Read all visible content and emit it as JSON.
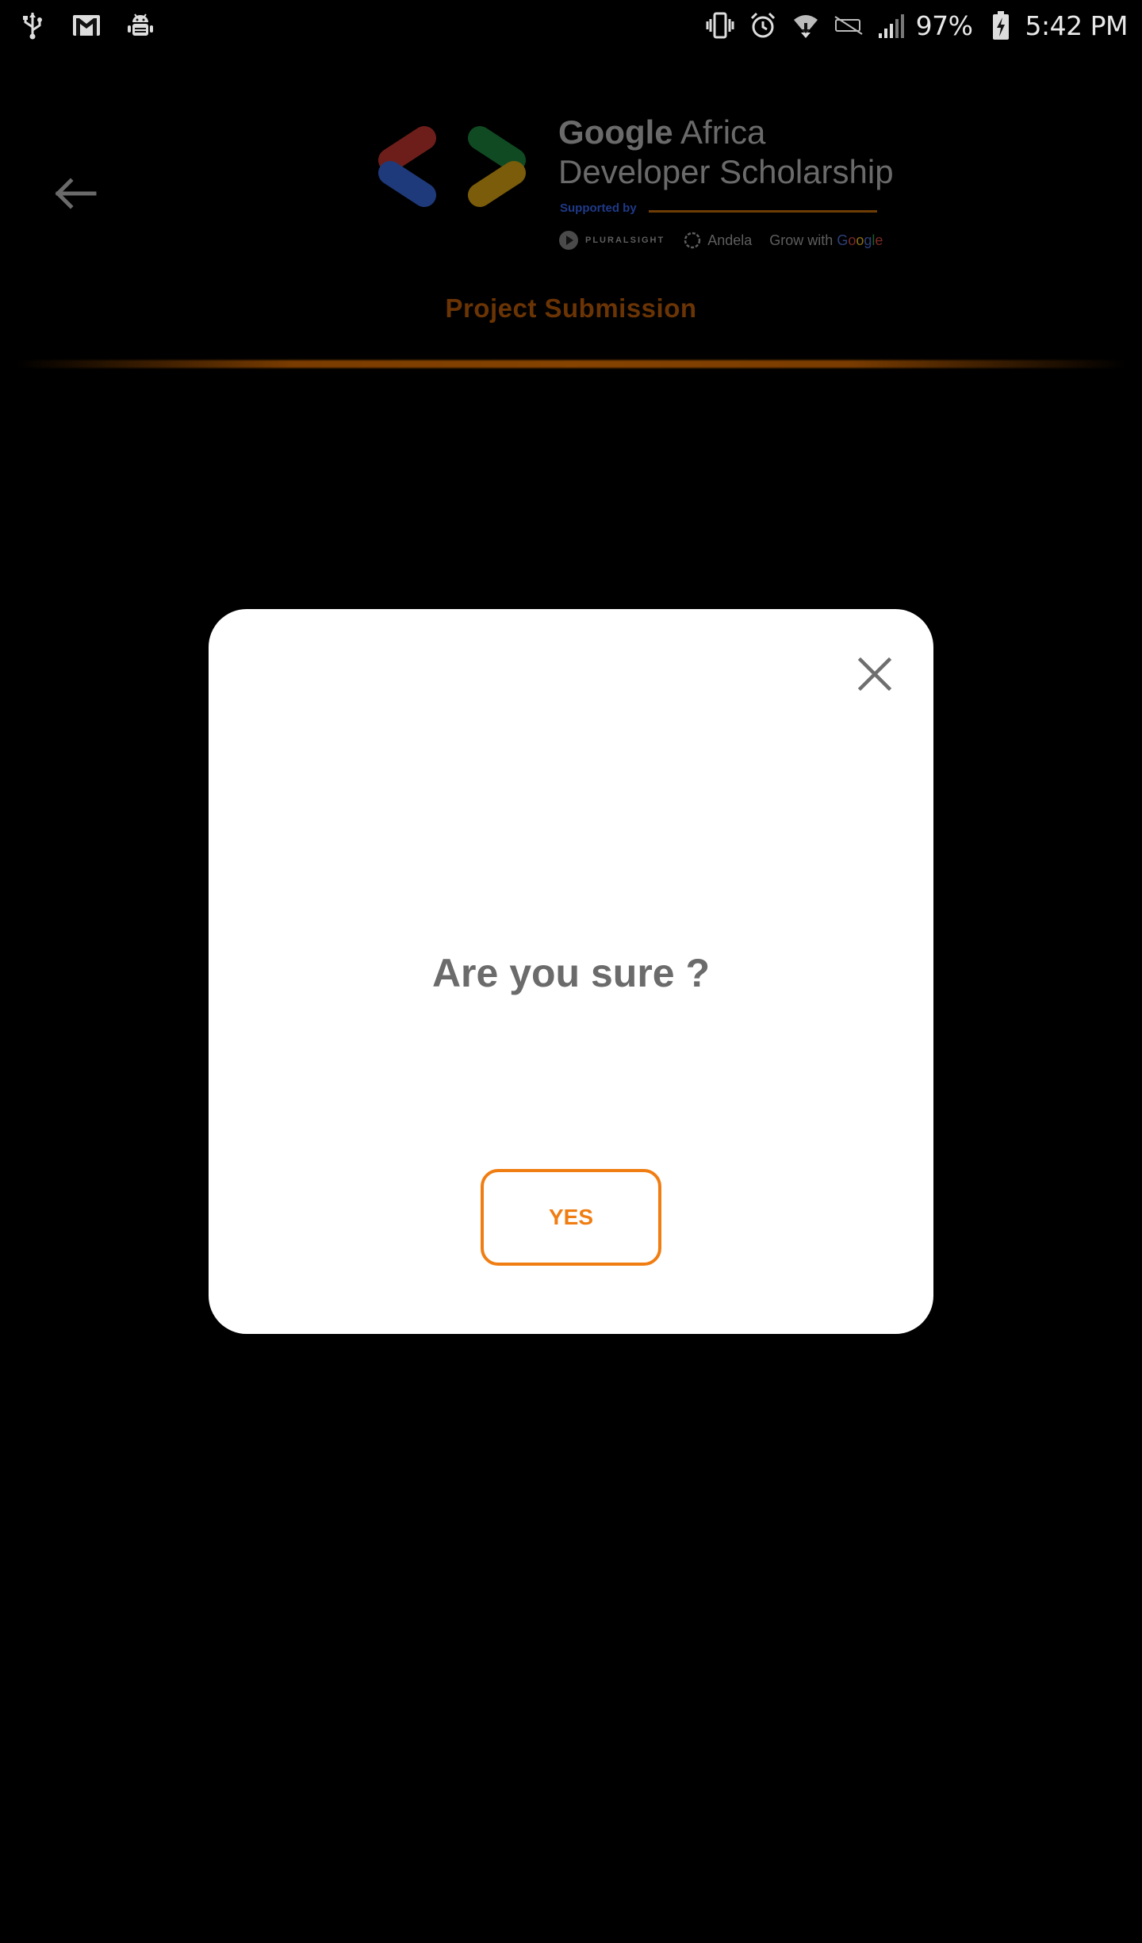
{
  "status_bar": {
    "left_icons": [
      "usb-icon",
      "gmail-icon",
      "android-debug-icon"
    ],
    "right_icons": [
      "vibrate-icon",
      "alarm-icon",
      "wifi-icon",
      "no-sim-icon",
      "signal-icon",
      "battery-charging-icon"
    ],
    "battery": "97%",
    "time": "5:42 PM"
  },
  "header": {
    "back_icon": "arrow-left-icon",
    "brand": {
      "title_strong": "Google",
      "title_line1_rest": " Africa",
      "title_line2": "Developer Scholarship",
      "supported_by": "Supported by",
      "partners": {
        "pluralsight": "PLURALSIGHT",
        "andela": "Andela",
        "grow_prefix": "Grow with ",
        "google_letters": [
          "G",
          "o",
          "o",
          "g",
          "l",
          "e"
        ]
      }
    },
    "page_title": "Project Submission"
  },
  "modal": {
    "close_icon": "close-icon",
    "message": "Are you sure ?",
    "yes_label": "YES"
  },
  "colors": {
    "accent": "#f07d12",
    "dialog_text": "#6b6b6b",
    "title_dimmed": "#6b3404",
    "background": "#000000"
  }
}
